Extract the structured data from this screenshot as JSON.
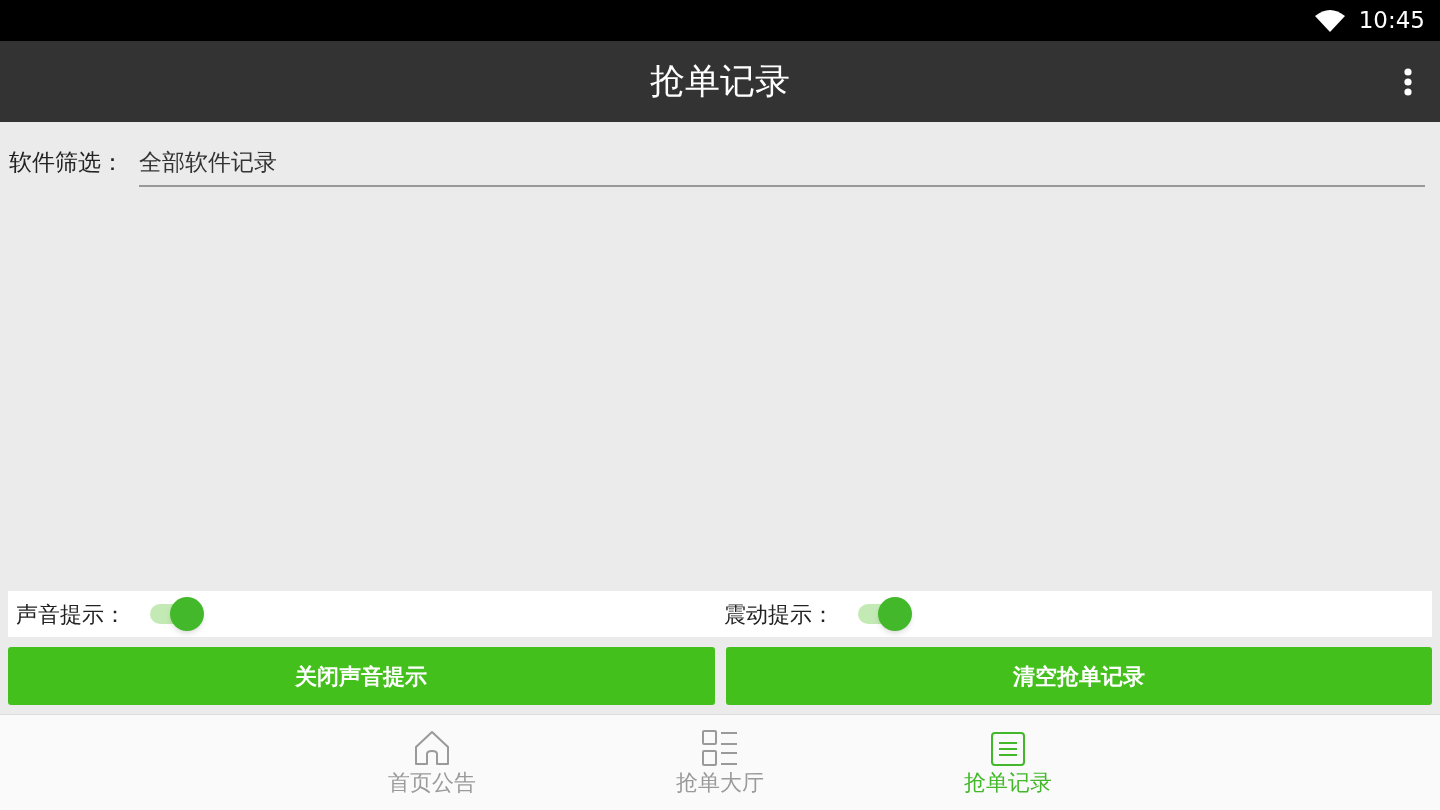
{
  "status_bar": {
    "time": "10:45"
  },
  "app_bar": {
    "title": "抢单记录"
  },
  "filter": {
    "label": "软件筛选：",
    "value": "全部软件记录"
  },
  "toggles": [
    {
      "label": "声音提示：",
      "on": true
    },
    {
      "label": "震动提示：",
      "on": true
    }
  ],
  "buttons": [
    "关闭声音提示",
    "清空抢单记录"
  ],
  "bottom_nav": [
    {
      "label": "首页公告",
      "kind": "home",
      "selected": false
    },
    {
      "label": "抢单大厅",
      "kind": "hall",
      "selected": false
    },
    {
      "label": "抢单记录",
      "kind": "records",
      "selected": true
    }
  ]
}
